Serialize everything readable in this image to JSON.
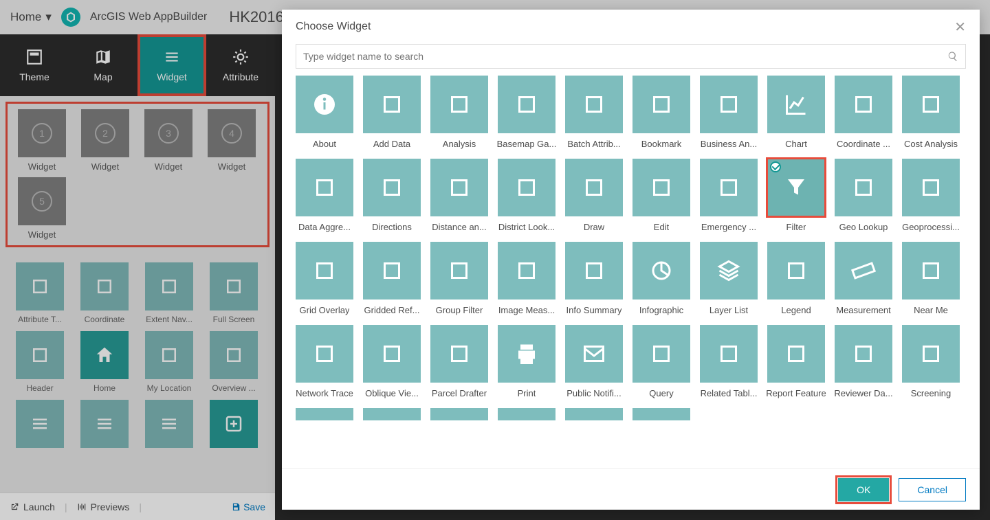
{
  "topbar": {
    "home": "Home",
    "brand": "ArcGIS Web AppBuilder",
    "title": "HK2016"
  },
  "configTabs": [
    {
      "key": "theme",
      "label": "Theme",
      "icon": "theme-icon"
    },
    {
      "key": "map",
      "label": "Map",
      "icon": "map-icon"
    },
    {
      "key": "widget",
      "label": "Widget",
      "icon": "widget-icon",
      "active": true,
      "highlight": true
    },
    {
      "key": "attribute",
      "label": "Attribute",
      "icon": "attribute-icon"
    }
  ],
  "slots": [
    {
      "num": "1",
      "label": "Widget"
    },
    {
      "num": "2",
      "label": "Widget"
    },
    {
      "num": "3",
      "label": "Widget"
    },
    {
      "num": "4",
      "label": "Widget"
    },
    {
      "num": "5",
      "label": "Widget"
    }
  ],
  "presets": [
    {
      "label": "Attribute T...",
      "icon": "table-icon"
    },
    {
      "label": "Coordinate",
      "icon": "axes-icon"
    },
    {
      "label": "Extent Nav...",
      "icon": "extent-icon"
    },
    {
      "label": "Full Screen",
      "icon": "fullscreen-icon"
    },
    {
      "label": "Header",
      "icon": "header-icon"
    },
    {
      "label": "Home",
      "icon": "home-icon",
      "dark": true
    },
    {
      "label": "My Location",
      "icon": "target-icon"
    },
    {
      "label": "Overview ...",
      "icon": "binoculars-icon"
    },
    {
      "label": "",
      "icon": "widget-icon"
    },
    {
      "label": "",
      "icon": "widget-icon"
    },
    {
      "label": "",
      "icon": "widget-icon"
    },
    {
      "label": "",
      "icon": "plus-icon",
      "dark": true
    }
  ],
  "bottom": {
    "launch": "Launch",
    "previews": "Previews",
    "save": "Save"
  },
  "modal": {
    "title": "Choose Widget",
    "searchPlaceholder": "Type widget name to search",
    "ok": "OK",
    "cancel": "Cancel",
    "widgets": [
      {
        "label": "About",
        "icon": "info-icon"
      },
      {
        "label": "Add Data",
        "icon": "bag-icon"
      },
      {
        "label": "Analysis",
        "icon": "dashboard-icon"
      },
      {
        "label": "Basemap Ga...",
        "icon": "grid4-icon"
      },
      {
        "label": "Batch Attrib...",
        "icon": "form-gear-icon"
      },
      {
        "label": "Bookmark",
        "icon": "bookmark-icon"
      },
      {
        "label": "Business An...",
        "icon": "pin-ring-icon"
      },
      {
        "label": "Chart",
        "icon": "chart-icon"
      },
      {
        "label": "Coordinate ...",
        "icon": "xyz-icon"
      },
      {
        "label": "Cost Analysis",
        "icon": "money-icon"
      },
      {
        "label": "Data Aggre...",
        "icon": "aggregate-icon"
      },
      {
        "label": "Directions",
        "icon": "route-icon"
      },
      {
        "label": "Distance an...",
        "icon": "distance-icon"
      },
      {
        "label": "District Look...",
        "icon": "district-icon"
      },
      {
        "label": "Draw",
        "icon": "palette-icon"
      },
      {
        "label": "Edit",
        "icon": "edit-icon"
      },
      {
        "label": "Emergency ...",
        "icon": "horn-icon"
      },
      {
        "label": "Filter",
        "icon": "filter-icon",
        "selected": true
      },
      {
        "label": "Geo Lookup",
        "icon": "geolookup-icon"
      },
      {
        "label": "Geoprocessi...",
        "icon": "toolbox-icon"
      },
      {
        "label": "Grid Overlay",
        "icon": "gridov-icon"
      },
      {
        "label": "Gridded Ref...",
        "icon": "gridref-icon"
      },
      {
        "label": "Group Filter",
        "icon": "groupfilter-icon"
      },
      {
        "label": "Image Meas...",
        "icon": "building-icon"
      },
      {
        "label": "Info Summary",
        "icon": "infosum-icon"
      },
      {
        "label": "Infographic",
        "icon": "pie-icon"
      },
      {
        "label": "Layer List",
        "icon": "layers-icon"
      },
      {
        "label": "Legend",
        "icon": "legend-icon"
      },
      {
        "label": "Measurement",
        "icon": "ruler-icon"
      },
      {
        "label": "Near Me",
        "icon": "nearme-icon"
      },
      {
        "label": "Network Trace",
        "icon": "nettrace-icon"
      },
      {
        "label": "Oblique Vie...",
        "icon": "oblique-icon"
      },
      {
        "label": "Parcel Drafter",
        "icon": "parcel-icon"
      },
      {
        "label": "Print",
        "icon": "print-icon"
      },
      {
        "label": "Public Notifi...",
        "icon": "mail-icon"
      },
      {
        "label": "Query",
        "icon": "query-icon"
      },
      {
        "label": "Related Tabl...",
        "icon": "relchart-icon"
      },
      {
        "label": "Report Feature",
        "icon": "report-icon"
      },
      {
        "label": "Reviewer Da...",
        "icon": "reviewdash-icon"
      },
      {
        "label": "Screening",
        "icon": "screening-icon"
      }
    ],
    "cutRowCount": 6
  }
}
